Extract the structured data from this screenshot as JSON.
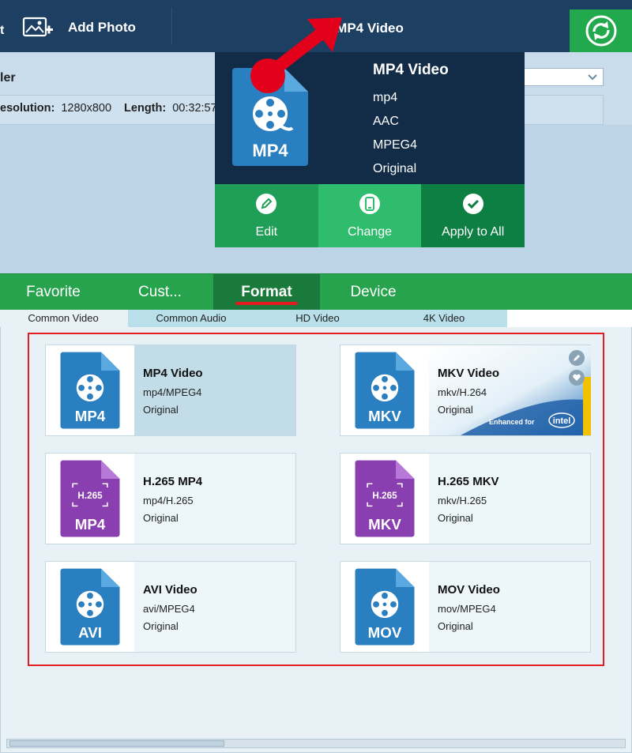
{
  "toolbar": {
    "edge_glyph": "t",
    "add_photo_label": "Add Photo",
    "profile_title": "MP4 Video",
    "convert_icon": "refresh-icon",
    "colors": {
      "bg": "#1d3f61",
      "convert": "#23a94d"
    }
  },
  "panel": {
    "heading_partial": "ler",
    "resolution_label": "esolution:",
    "resolution_value": "1280x800",
    "length_label": "Length:",
    "length_value": "00:32:57"
  },
  "popup": {
    "icon_label": "MP4",
    "name": "MP4 Video",
    "container": "mp4",
    "audio": "AAC",
    "video": "MPEG4",
    "quality": "Original",
    "actions": [
      {
        "label": "Edit",
        "icon": "pencil-icon"
      },
      {
        "label": "Change",
        "icon": "phone-icon"
      },
      {
        "label": "Apply to All",
        "icon": "check-icon"
      }
    ],
    "colors": {
      "edit": "#1e9e56",
      "change": "#2fbd6d",
      "apply": "#0e7f42",
      "bg": "#122c47"
    }
  },
  "category_tabs": [
    {
      "label": "Favorite",
      "active": false
    },
    {
      "label": "Cust...",
      "active": false
    },
    {
      "label": "Format",
      "active": true
    },
    {
      "label": "Device",
      "active": false
    }
  ],
  "sub_tabs": [
    {
      "label": "Common Video",
      "active": true
    },
    {
      "label": "Common Audio",
      "active": false
    },
    {
      "label": "HD Video",
      "active": false
    },
    {
      "label": "4K Video",
      "active": false
    }
  ],
  "formats": [
    {
      "name": "MP4 Video",
      "codec": "mp4/MPEG4",
      "quality": "Original",
      "icon_label": "MP4",
      "icon_top": "",
      "icon_color": "#2a7fc0",
      "selected": true
    },
    {
      "name": "MKV Video",
      "codec": "mkv/H.264",
      "quality": "Original",
      "icon_label": "MKV",
      "icon_top": "",
      "icon_color": "#2a7fc0",
      "selected": false,
      "badge": "Enhanced for",
      "badge_brand": "intel"
    },
    {
      "name": "H.265 MP4",
      "codec": "mp4/H.265",
      "quality": "Original",
      "icon_label": "MP4",
      "icon_top": "H.265",
      "icon_color": "#8a3fb0",
      "selected": false
    },
    {
      "name": "H.265 MKV",
      "codec": "mkv/H.265",
      "quality": "Original",
      "icon_label": "MKV",
      "icon_top": "H.265",
      "icon_color": "#8a3fb0",
      "selected": false
    },
    {
      "name": "AVI Video",
      "codec": "avi/MPEG4",
      "quality": "Original",
      "icon_label": "AVI",
      "icon_top": "",
      "icon_color": "#2a7fc0",
      "selected": false
    },
    {
      "name": "MOV Video",
      "codec": "mov/MPEG4",
      "quality": "Original",
      "icon_label": "MOV",
      "icon_top": "",
      "icon_color": "#2a7fc0",
      "selected": false
    }
  ]
}
